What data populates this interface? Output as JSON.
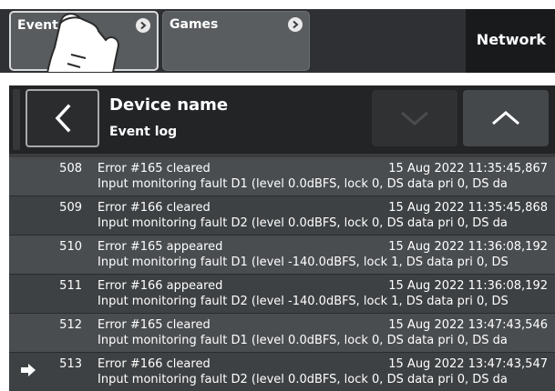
{
  "tabs": [
    {
      "label": "Event log",
      "active": true
    },
    {
      "label": "Games",
      "active": false
    },
    {
      "label": "Network",
      "active": false
    }
  ],
  "header": {
    "title": "Device name",
    "subtitle": "Event log"
  },
  "events": [
    {
      "num": "508",
      "message": "Error #165 cleared",
      "time": "15 Aug 2022 11:35:45,867",
      "detail": "Input monitoring fault D1 (level 0.0dBFS, lock 0, DS data pri 0, DS da"
    },
    {
      "num": "509",
      "message": "Error #166 cleared",
      "time": "15 Aug 2022 11:35:45,868",
      "detail": "Input monitoring fault D2 (level 0.0dBFS, lock 0, DS data pri 0, DS da"
    },
    {
      "num": "510",
      "message": "Error #165 appeared",
      "time": "15 Aug 2022 11:36:08,192",
      "detail": "Input monitoring fault D1 (level -140.0dBFS, lock 1, DS data pri 0, DS"
    },
    {
      "num": "511",
      "message": "Error #166 appeared",
      "time": "15 Aug 2022 11:36:08,192",
      "detail": "Input monitoring fault D2 (level -140.0dBFS, lock 1, DS data pri 0, DS"
    },
    {
      "num": "512",
      "message": "Error #165 cleared",
      "time": "15 Aug 2022 13:47:43,546",
      "detail": "Input monitoring fault D1 (level 0.0dBFS, lock 0, DS data pri 0, DS da"
    },
    {
      "num": "513",
      "message": "Error #166 cleared",
      "time": "15 Aug 2022 13:47:43,547",
      "detail": "Input monitoring fault D2 (level 0.0dBFS, lock 0, DS data pri 0, DS da"
    }
  ],
  "current_marker_index": 5,
  "colors": {
    "tab_bg": "#5a5d60",
    "header_bg": "#222426",
    "row_even": "#4a4d50",
    "row_odd": "#3e4143"
  }
}
